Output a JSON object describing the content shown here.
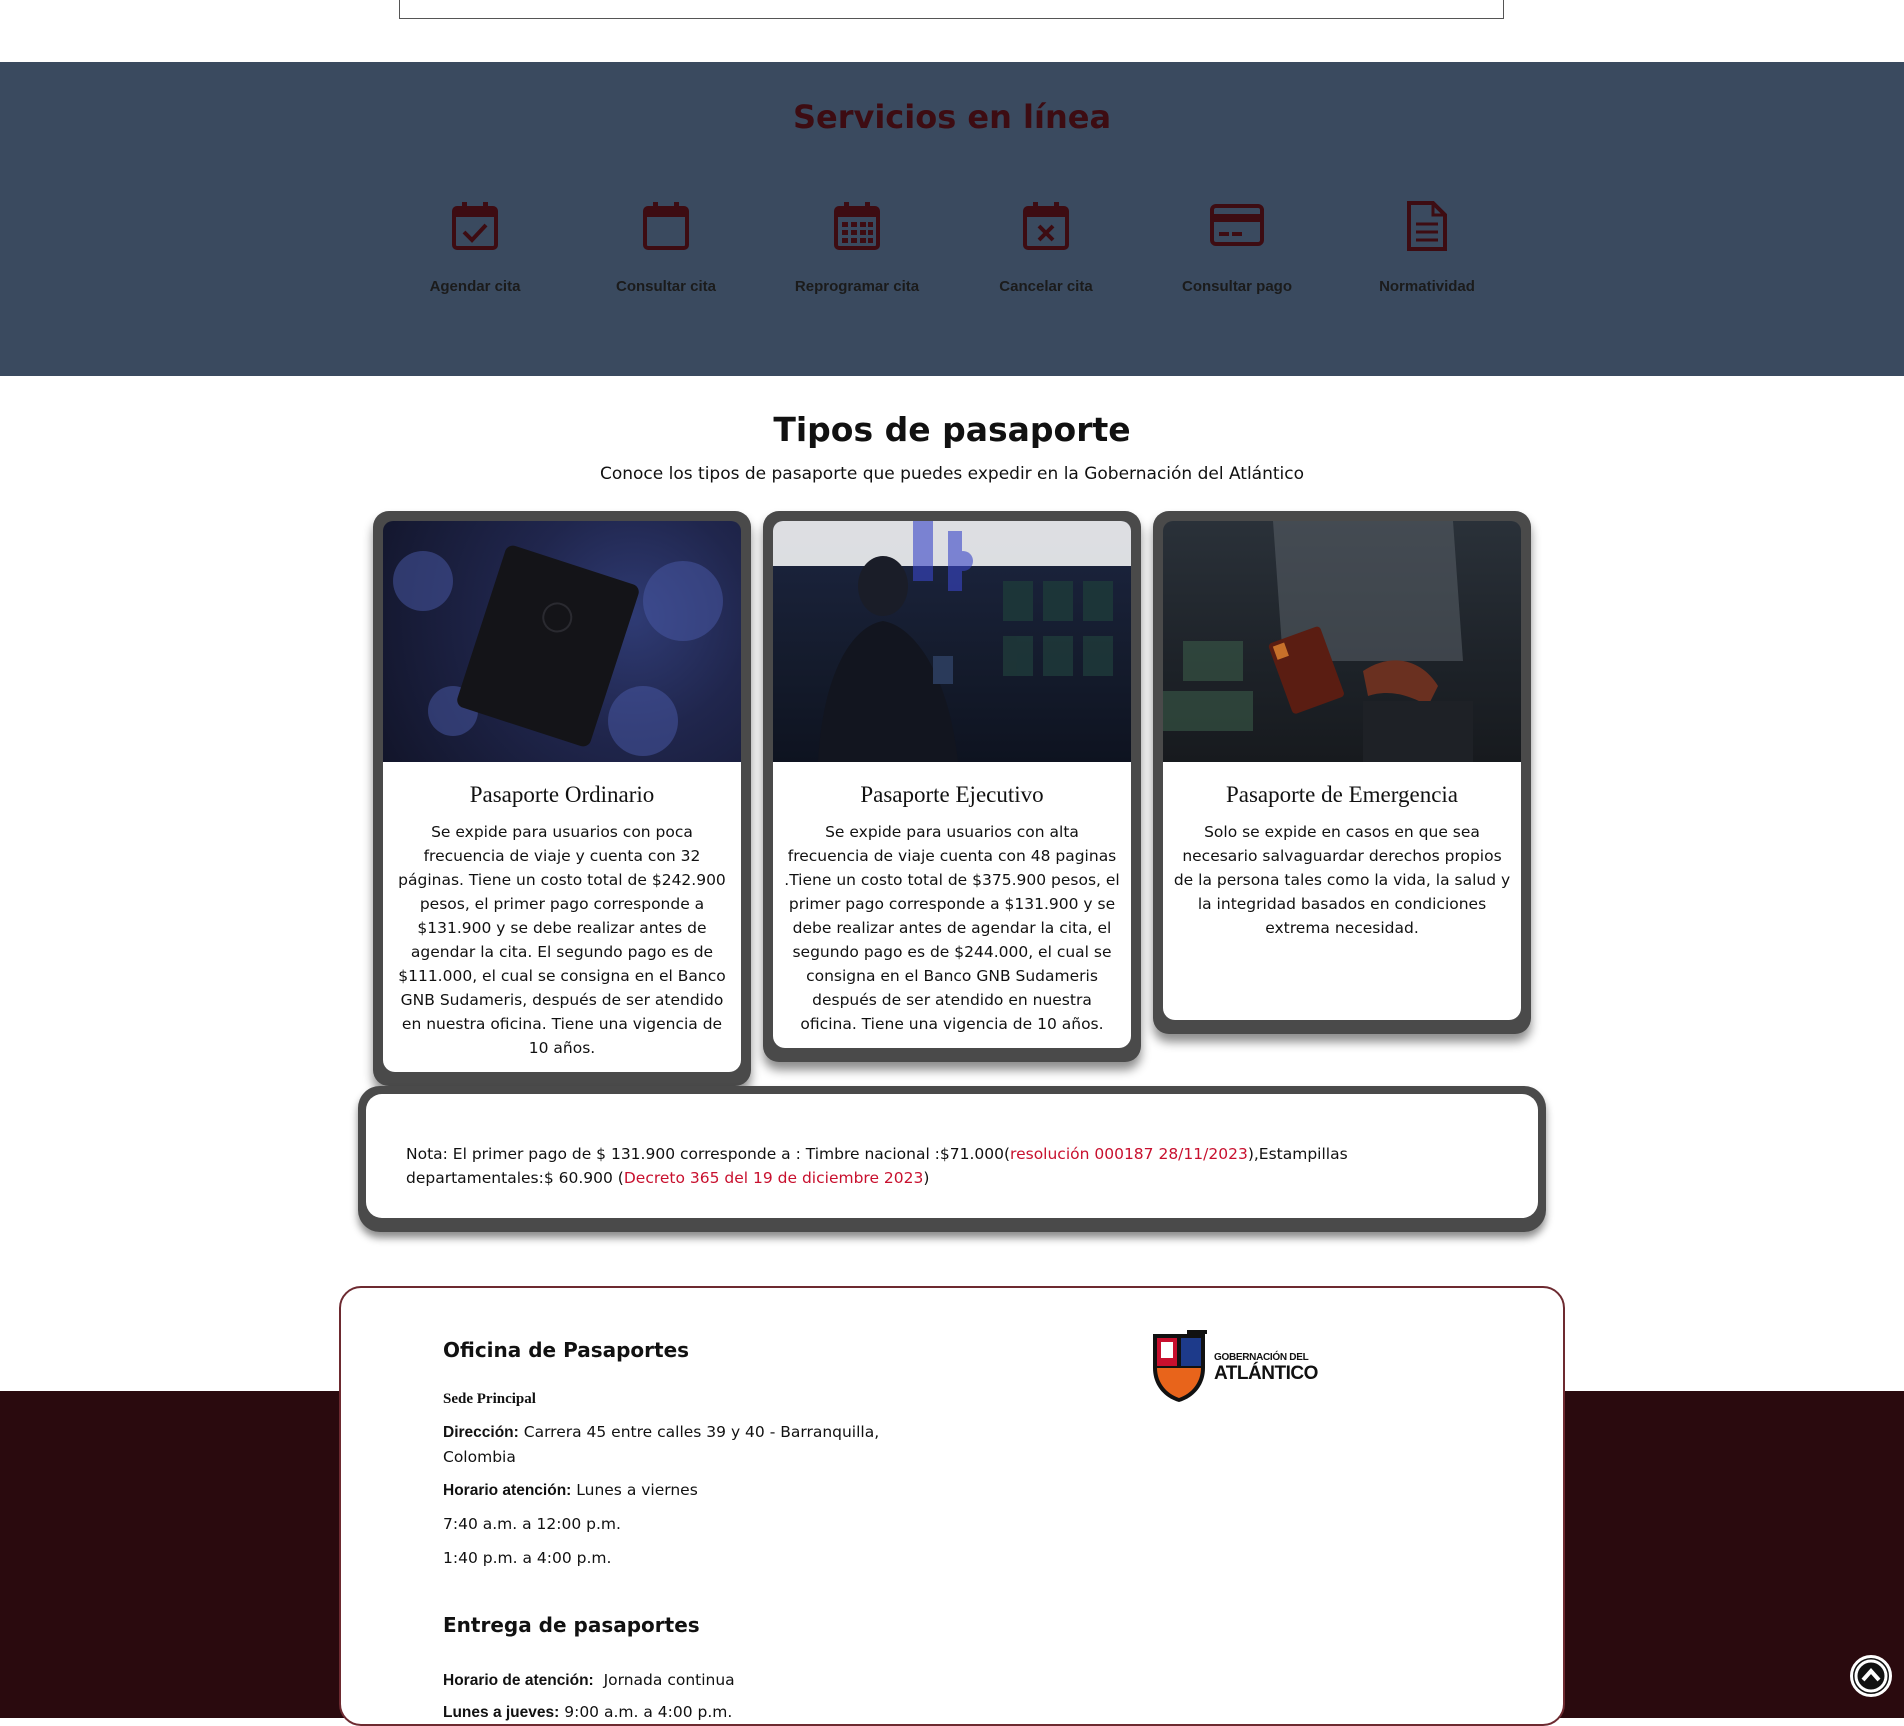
{
  "services": {
    "title": "Servicios en línea",
    "items": [
      {
        "label": "Agendar cita",
        "icon": "calendar-check-icon"
      },
      {
        "label": "Consultar cita",
        "icon": "calendar-icon"
      },
      {
        "label": "Reprogramar cita",
        "icon": "calendar-grid-icon"
      },
      {
        "label": "Cancelar cita",
        "icon": "calendar-x-icon"
      },
      {
        "label": "Consultar pago",
        "icon": "credit-card-icon"
      },
      {
        "label": "Normatividad",
        "icon": "document-icon"
      }
    ],
    "colors": {
      "band": "#3a4a5f",
      "icon": "#3d0c12"
    }
  },
  "types": {
    "title": "Tipos de pasaporte",
    "subtitle": "Conoce los tipos de pasaporte que puedes expedir en la Gobernación del Atlántico",
    "cards": [
      {
        "title": "Pasaporte Ordinario",
        "text": "Se expide para usuarios con poca frecuencia de viaje y cuenta con 32 páginas. Tiene un costo total de $242.900 pesos, el primer pago corresponde a $131.900 y se debe realizar antes de agendar la cita. El segundo pago es de $111.000, el cual se consigna en el Banco GNB Sudameris, después de ser atendido en nuestra oficina. Tiene una vigencia de 10 años."
      },
      {
        "title": "Pasaporte Ejecutivo",
        "text": "Se expide para usuarios con alta frecuencia de viaje cuenta con 48 paginas .Tiene un costo total de $375.900 pesos, el primer pago corresponde a $131.900 y se debe realizar antes de agendar la cita, el segundo pago es de $244.000, el cual se consigna en el Banco GNB Sudameris después de ser atendido en nuestra oficina. Tiene una vigencia de 10 años."
      },
      {
        "title": "Pasaporte de Emergencia",
        "text": "Solo se expide en casos en que sea necesario salvaguardar derechos propios de la persona tales como la vida, la salud y la integridad basados en condiciones extrema necesidad."
      }
    ]
  },
  "note": {
    "prefix": "Nota: El primer pago de $ 131.900 corresponde a : Timbre nacional :$71.000(",
    "link1": "resolución 000187 28/11/2023",
    "middle": "),Estampillas departamentales:$ 60.900 (",
    "link2": "Decreto 365 del 19 de diciembre 2023",
    "suffix": ")",
    "link_color": "#c8102e"
  },
  "office": {
    "title": "Oficina de Pasaportes",
    "sede": "Sede Principal",
    "direccion_label": "Dirección:",
    "direccion": "Carrera 45 entre calles 39 y 40 - Barranquilla, Colombia",
    "horario_label": "Horario atención:",
    "horario": "Lunes a viernes",
    "turno1": "7:40 a.m. a 12:00 p.m.",
    "turno2": "1:40 p.m. a 4:00 p.m.",
    "entrega_title": "Entrega de pasaportes",
    "entrega_horario_label": "Horario de atención:",
    "entrega_horario": "Jornada continua",
    "entrega_dias_label": "Lunes a jueves:",
    "entrega_dias": "9:00 a.m. a 4:00 p.m.",
    "logo_line1": "GOBERNACIÓN DEL",
    "logo_line2": "ATLÁNTICO"
  },
  "footer": {
    "color": "#2a0a0e"
  }
}
